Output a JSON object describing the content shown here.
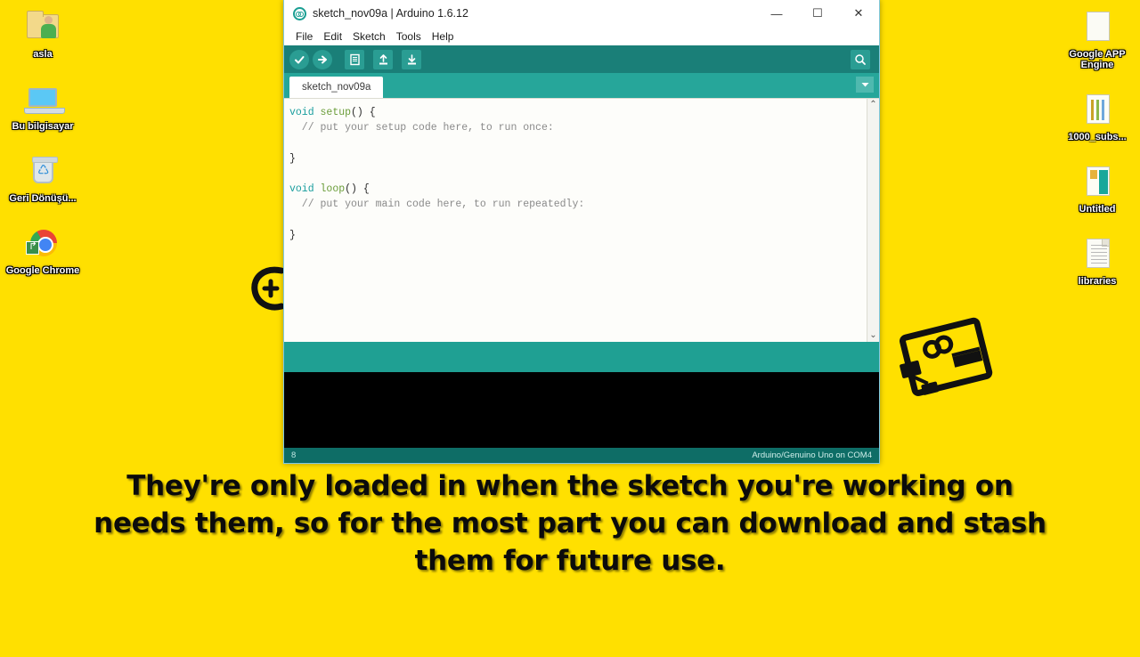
{
  "desktop": {
    "background_color": "#FFE000",
    "icons_left": [
      {
        "label": "asla",
        "icon": "user-folder-icon"
      },
      {
        "label": "Bu bilgisayar",
        "icon": "this-pc-icon"
      },
      {
        "label": "Geri Dönüşü...",
        "icon": "recycle-bin-icon"
      },
      {
        "label": "Google Chrome",
        "icon": "google-chrome-icon"
      }
    ],
    "icons_right": [
      {
        "label": "Google APP Engine",
        "icon": "folder-document-icon"
      },
      {
        "label": "1000_subs...",
        "icon": "document-columns-icon"
      },
      {
        "label": "Untitled",
        "icon": "book-document-icon"
      },
      {
        "label": "libraries",
        "icon": "lined-document-icon"
      }
    ],
    "watermarks": [
      {
        "name": "arduino-infinity-mark",
        "color": "#111111"
      },
      {
        "name": "arduino-board-mark",
        "color": "#111111"
      }
    ]
  },
  "window": {
    "title": "sketch_nov09a | Arduino 1.6.12",
    "app_icon": "arduino-logo-icon",
    "controls": {
      "minimize": "—",
      "maximize": "☐",
      "close": "✕"
    },
    "menu": [
      {
        "label": "File"
      },
      {
        "label": "Edit"
      },
      {
        "label": "Sketch"
      },
      {
        "label": "Tools"
      },
      {
        "label": "Help"
      }
    ],
    "toolbar": {
      "background_color": "#1a7f78",
      "buttons": [
        {
          "name": "verify-button",
          "icon": "check-icon",
          "glyph": "✓"
        },
        {
          "name": "upload-button",
          "icon": "arrow-right-icon",
          "glyph": "➜"
        },
        {
          "name": "new-button",
          "icon": "page-icon",
          "glyph": "❐"
        },
        {
          "name": "open-button",
          "icon": "arrow-up-icon",
          "glyph": "↑"
        },
        {
          "name": "save-button",
          "icon": "arrow-down-icon",
          "glyph": "↓"
        }
      ],
      "serial_monitor": {
        "name": "serial-monitor-button",
        "icon": "magnifier-icon",
        "glyph": "⌕"
      }
    },
    "tabs": {
      "active": "sketch_nov09a",
      "dropdown_glyph": "▼"
    },
    "editor": {
      "background_color": "#fdfdfa",
      "lines": [
        [
          {
            "t": "void ",
            "c": "kw"
          },
          {
            "t": "setup",
            "c": "fn"
          },
          {
            "t": "() {",
            "c": "pl"
          }
        ],
        [
          {
            "t": "  // put your setup code here, to run once:",
            "c": "cm"
          }
        ],
        [
          {
            "t": "",
            "c": "pl"
          }
        ],
        [
          {
            "t": "}",
            "c": "pl"
          }
        ],
        [
          {
            "t": "",
            "c": "pl"
          }
        ],
        [
          {
            "t": "void ",
            "c": "kw"
          },
          {
            "t": "loop",
            "c": "fn"
          },
          {
            "t": "() {",
            "c": "pl"
          }
        ],
        [
          {
            "t": "  // put your main code here, to run repeatedly:",
            "c": "cm"
          }
        ],
        [
          {
            "t": "",
            "c": "pl"
          }
        ],
        [
          {
            "t": "}",
            "c": "pl"
          }
        ]
      ],
      "scrollbar": {
        "up_glyph": "⌃",
        "down_glyph": "⌄"
      }
    },
    "console": {
      "status_strip_color": "#1fa093",
      "output_color": "#000000",
      "output_text": ""
    },
    "statusbar": {
      "line_number": "8",
      "board": "Arduino/Genuino Uno on COM4",
      "background_color": "#0e6d66"
    }
  },
  "subtitle": {
    "text": "They're only loaded in when the sketch you're working on needs them, so for the most part you can download and stash them for future use."
  }
}
